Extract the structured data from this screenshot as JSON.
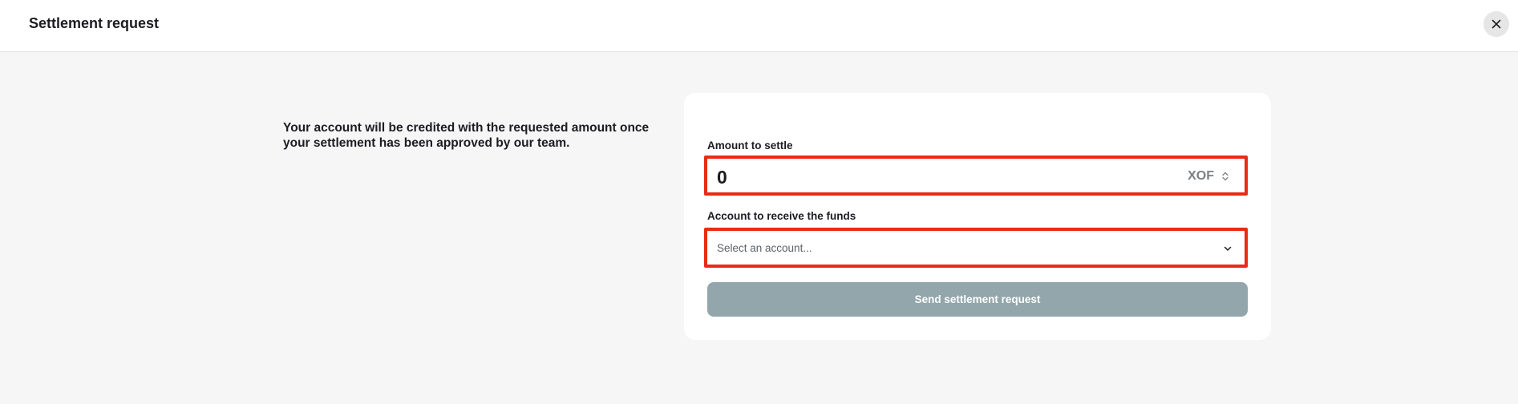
{
  "header": {
    "title": "Settlement request",
    "close_icon": "close-icon"
  },
  "intro": {
    "text": "Your account will be credited with the requested amount once your settlement has been approved by our team."
  },
  "form": {
    "amount": {
      "label": "Amount to settle",
      "value": "0",
      "currency": "XOF",
      "currency_icon": "updown-chevron-icon"
    },
    "account": {
      "label": "Account to receive the funds",
      "placeholder": "Select an account...",
      "icon": "chevron-down-icon"
    },
    "submit_label": "Send settlement request"
  },
  "colors": {
    "page_background": "#f6f6f6",
    "highlight_border": "#ea2a16",
    "button_disabled": "#92a6ab",
    "text_primary": "#1c1c22"
  }
}
